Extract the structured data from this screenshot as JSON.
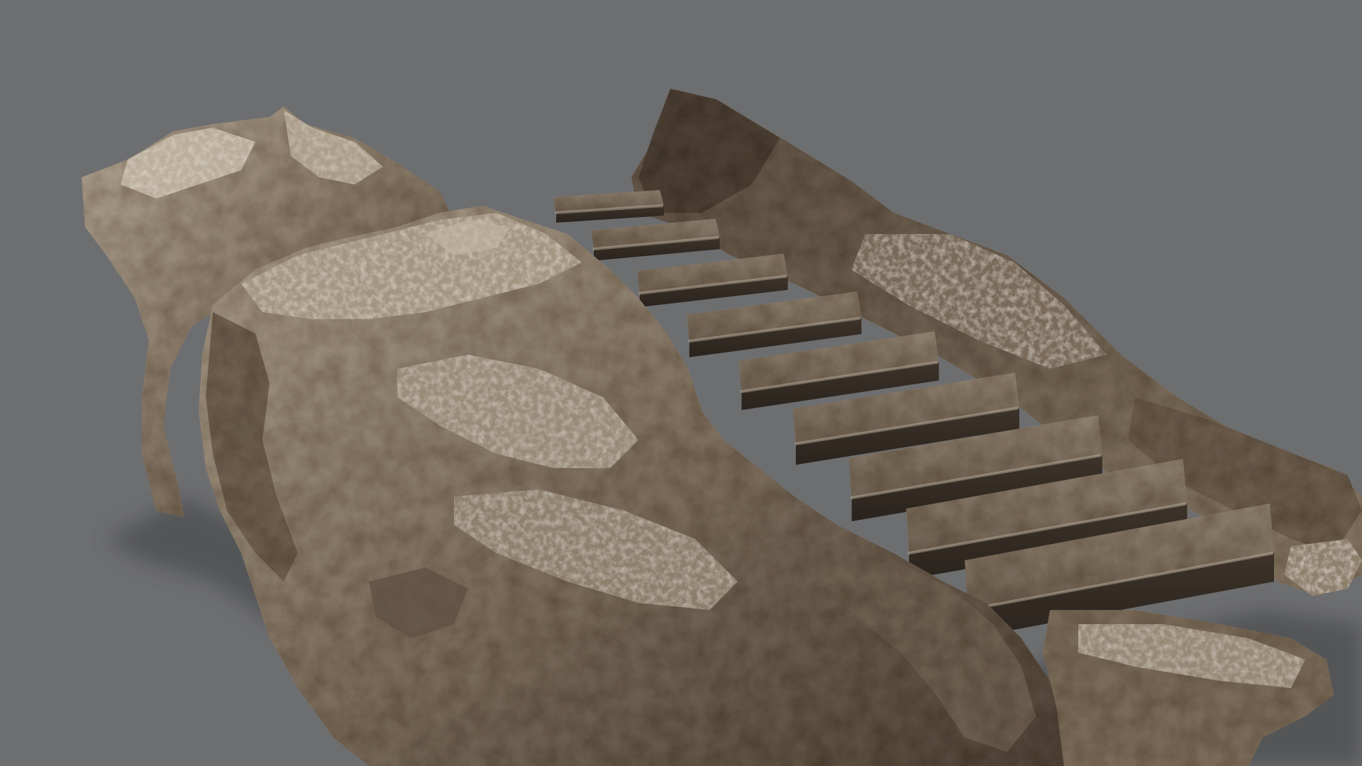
{
  "scene": {
    "subject": "rock-staircase-3d-model",
    "background_color": "#6d6e70",
    "shadow_color": "#4f5052",
    "rock_colors": {
      "light": "#a39684",
      "mid": "#7e6f5e",
      "dark": "#4b4035",
      "deep": "#2f2822",
      "highlight": "#c2b6a3"
    },
    "step_count": 9
  }
}
